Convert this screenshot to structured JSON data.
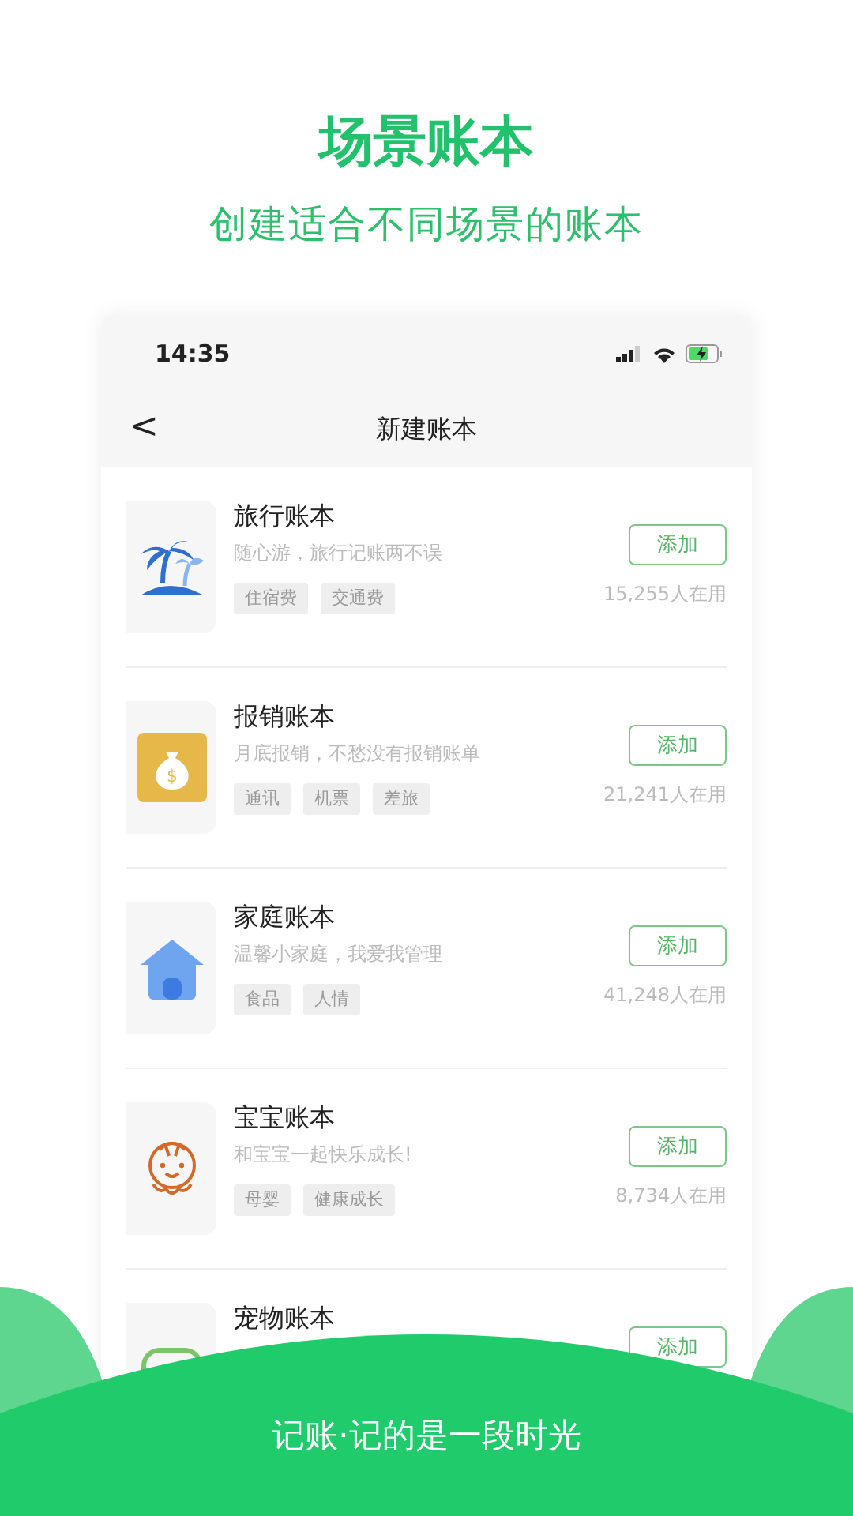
{
  "header": {
    "title": "场景账本",
    "subtitle": "创建适合不同场景的账本"
  },
  "phone": {
    "status_time": "14:35",
    "nav": {
      "back": "<",
      "title": "新建账本"
    },
    "items": [
      {
        "kind": "travel",
        "title": "旅行账本",
        "desc": "随心游，旅行记账两不误",
        "tags": [
          "住宿费",
          "交通费"
        ],
        "button": "添加",
        "users": "15,255人在用"
      },
      {
        "kind": "reimburse",
        "icon_text": "$",
        "title": "报销账本",
        "desc": "月底报销，不愁没有报销账单",
        "tags": [
          "通讯",
          "机票",
          "差旅"
        ],
        "button": "添加",
        "users": "21,241人在用"
      },
      {
        "kind": "home",
        "title": "家庭账本",
        "desc": "温馨小家庭，我爱我管理",
        "tags": [
          "食品",
          "人情"
        ],
        "button": "添加",
        "users": "41,248人在用"
      },
      {
        "kind": "baby",
        "title": "宝宝账本",
        "desc": "和宝宝一起快乐成长!",
        "tags": [
          "母婴",
          "健康成长"
        ],
        "button": "添加",
        "users": "8,734人在用"
      },
      {
        "kind": "pet",
        "title": "宠物账本",
        "button": "添加"
      }
    ]
  },
  "footer": {
    "slogan": "记账·记的是一段时光"
  }
}
